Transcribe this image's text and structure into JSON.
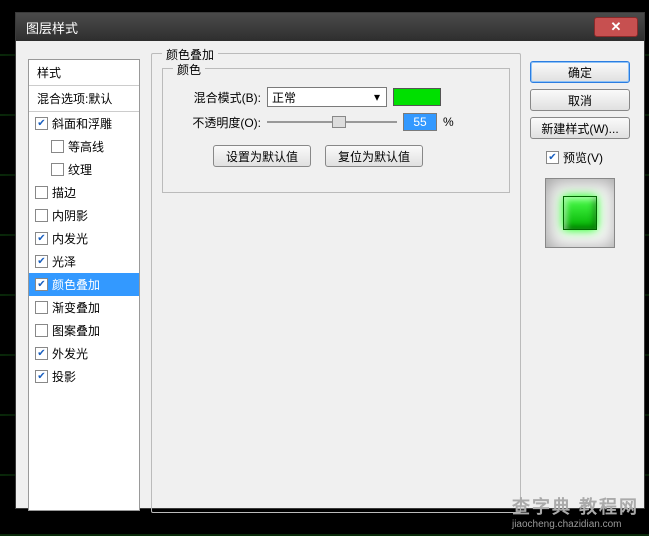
{
  "window": {
    "title": "图层样式"
  },
  "styles": {
    "header": "样式",
    "blendDefault": "混合选项:默认",
    "items": [
      {
        "label": "斜面和浮雕",
        "checked": true,
        "indent": false
      },
      {
        "label": "等高线",
        "checked": false,
        "indent": true
      },
      {
        "label": "纹理",
        "checked": false,
        "indent": true
      },
      {
        "label": "描边",
        "checked": false,
        "indent": false
      },
      {
        "label": "内阴影",
        "checked": false,
        "indent": false
      },
      {
        "label": "内发光",
        "checked": true,
        "indent": false
      },
      {
        "label": "光泽",
        "checked": true,
        "indent": false
      },
      {
        "label": "颜色叠加",
        "checked": true,
        "indent": false,
        "selected": true
      },
      {
        "label": "渐变叠加",
        "checked": false,
        "indent": false
      },
      {
        "label": "图案叠加",
        "checked": false,
        "indent": false
      },
      {
        "label": "外发光",
        "checked": true,
        "indent": false
      },
      {
        "label": "投影",
        "checked": true,
        "indent": false
      }
    ]
  },
  "panel": {
    "groupTitle": "颜色叠加",
    "colorGroup": "颜色",
    "blendModeLabel": "混合模式(B):",
    "blendModeValue": "正常",
    "opacityLabel": "不透明度(O):",
    "opacityValue": "55",
    "opacityUnit": "%",
    "swatchColor": "#00e000",
    "setDefault": "设置为默认值",
    "resetDefault": "复位为默认值"
  },
  "actions": {
    "ok": "确定",
    "cancel": "取消",
    "newStyle": "新建样式(W)...",
    "previewLabel": "预览(V)",
    "previewChecked": true
  },
  "watermark": {
    "line1": "查字典 教程网",
    "line2": "jiaocheng.chazidian.com"
  }
}
